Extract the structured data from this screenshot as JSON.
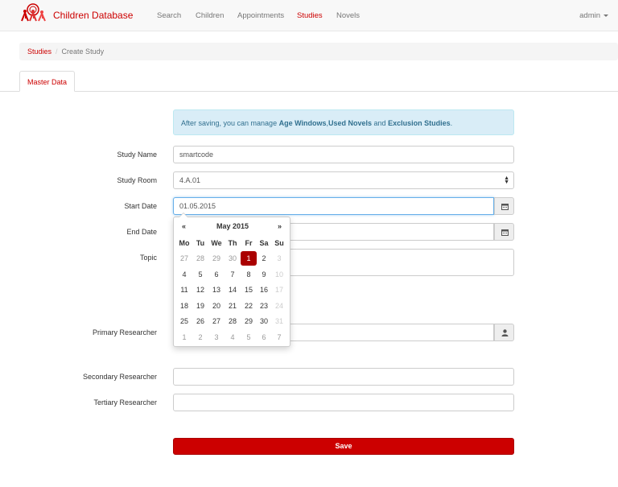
{
  "brand": {
    "name": "Children Database"
  },
  "nav": {
    "items": [
      "Search",
      "Children",
      "Appointments",
      "Studies",
      "Novels"
    ],
    "active": "Studies",
    "user": "admin"
  },
  "breadcrumb": {
    "parent": "Studies",
    "current": "Create Study"
  },
  "tabs": {
    "master_data": "Master Data"
  },
  "alert": {
    "prefix": "After saving, you can manage ",
    "link1": "Age Windows",
    "sep1": ",",
    "link2": "Used Novels",
    "sep2": " and ",
    "link3": "Exclusion Studies",
    "suffix": "."
  },
  "form": {
    "study_name": {
      "label": "Study Name",
      "value": "smartcode"
    },
    "study_room": {
      "label": "Study Room",
      "value": "4.A.01"
    },
    "start_date": {
      "label": "Start Date",
      "value": "01.05.2015"
    },
    "end_date": {
      "label": "End Date",
      "value": ""
    },
    "topic": {
      "label": "Topic",
      "value": ""
    },
    "primary_researcher": {
      "label": "Primary Researcher",
      "value": ""
    },
    "secondary_researcher": {
      "label": "Secondary Researcher",
      "value": ""
    },
    "tertiary_researcher": {
      "label": "Tertiary Researcher",
      "value": ""
    }
  },
  "datepicker": {
    "prev": "«",
    "title": "May 2015",
    "next": "»",
    "weekdays": [
      "Mo",
      "Tu",
      "We",
      "Th",
      "Fr",
      "Sa",
      "Su"
    ],
    "weeks": [
      [
        "27",
        "28",
        "29",
        "30",
        "1",
        "2",
        "3"
      ],
      [
        "4",
        "5",
        "6",
        "7",
        "8",
        "9",
        "10"
      ],
      [
        "11",
        "12",
        "13",
        "14",
        "15",
        "16",
        "17"
      ],
      [
        "18",
        "19",
        "20",
        "21",
        "22",
        "23",
        "24"
      ],
      [
        "25",
        "26",
        "27",
        "28",
        "29",
        "30",
        "31"
      ],
      [
        "1",
        "2",
        "3",
        "4",
        "5",
        "6",
        "7"
      ]
    ],
    "selected": "1"
  },
  "buttons": {
    "save": "Save"
  },
  "colors": {
    "accent": "#cc0000",
    "selected_day": "#aa0000",
    "alert_bg": "#d9edf7"
  },
  "icons": {
    "calendar": "calendar-icon",
    "user": "user-icon",
    "logo": "logo-icon"
  }
}
